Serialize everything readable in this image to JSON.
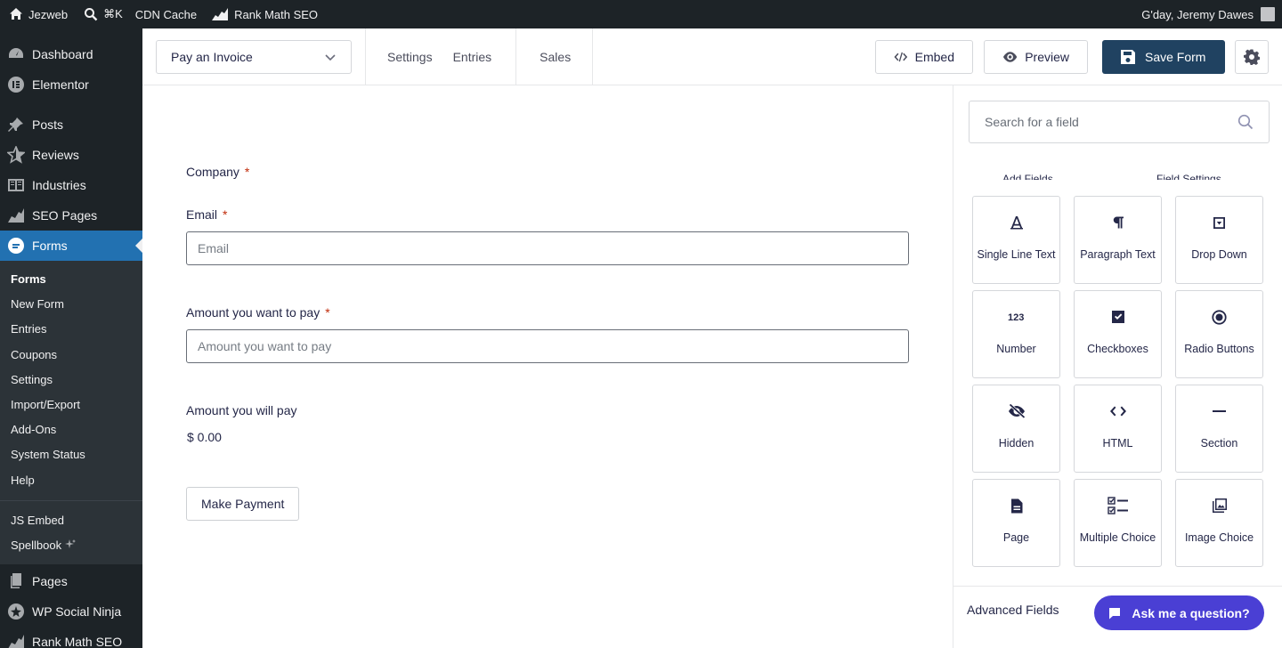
{
  "adminbar": {
    "site_name": "Jezweb",
    "shortcut": "⌘K",
    "cdn": "CDN Cache",
    "seo": "Rank Math SEO",
    "greeting": "G'day, Jeremy Dawes"
  },
  "menu": {
    "dashboard": "Dashboard",
    "elementor": "Elementor",
    "posts": "Posts",
    "reviews": "Reviews",
    "industries": "Industries",
    "seo_pages": "SEO Pages",
    "forms": "Forms",
    "pages": "Pages",
    "wp_social_ninja": "WP Social Ninja",
    "rank_math": "Rank Math SEO"
  },
  "submenu": {
    "items": [
      "Forms",
      "New Form",
      "Entries",
      "Coupons",
      "Settings",
      "Import/Export",
      "Add-Ons",
      "System Status",
      "Help"
    ],
    "extra": [
      "JS Embed",
      "Spellbook"
    ]
  },
  "toolbar": {
    "form_name": "Pay an Invoice",
    "settings": "Settings",
    "entries": "Entries",
    "sales": "Sales",
    "embed": "Embed",
    "preview": "Preview",
    "save": "Save Form"
  },
  "form": {
    "company_label": "Company",
    "required_mark": "*",
    "email_label": "Email",
    "email_placeholder": "Email",
    "amount_label": "Amount you want to pay",
    "amount_placeholder": "Amount you want to pay",
    "total_label": "Amount you will pay",
    "total_value": "$ 0.00",
    "submit_label": "Make Payment"
  },
  "panel": {
    "search_placeholder": "Search for a field",
    "tab_add": "Add Fields",
    "tab_settings": "Field Settings",
    "fields": [
      {
        "label": "Single Line Text",
        "icon": "single-line-text-icon"
      },
      {
        "label": "Paragraph Text",
        "icon": "paragraph-icon"
      },
      {
        "label": "Drop Down",
        "icon": "dropdown-icon"
      },
      {
        "label": "Number",
        "icon": "number-icon"
      },
      {
        "label": "Checkboxes",
        "icon": "checkbox-icon"
      },
      {
        "label": "Radio Buttons",
        "icon": "radio-icon"
      },
      {
        "label": "Hidden",
        "icon": "hidden-icon"
      },
      {
        "label": "HTML",
        "icon": "html-icon"
      },
      {
        "label": "Section",
        "icon": "section-icon"
      },
      {
        "label": "Page",
        "icon": "page-icon"
      },
      {
        "label": "Multiple Choice",
        "icon": "multiple-choice-icon"
      },
      {
        "label": "Image Choice",
        "icon": "image-choice-icon"
      }
    ],
    "advanced": "Advanced Fields"
  },
  "chat": {
    "label": "Ask me a question?"
  }
}
